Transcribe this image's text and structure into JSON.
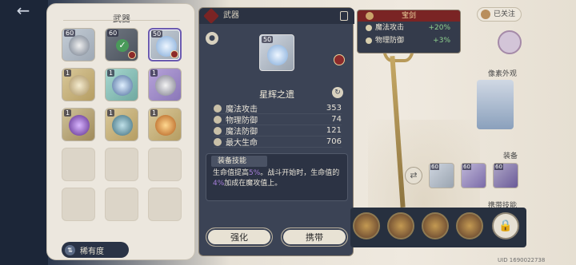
{
  "inventory": {
    "title": "武器",
    "rarity_label": "稀有度",
    "slots": [
      {
        "level": "60",
        "kind": "filled",
        "has_badge": false,
        "check": false
      },
      {
        "level": "60",
        "kind": "filled",
        "has_badge": true,
        "check": true
      },
      {
        "level": "50",
        "kind": "selected",
        "has_badge": true,
        "check": false
      },
      {
        "level": "1",
        "kind": "gold",
        "has_badge": false,
        "check": false
      },
      {
        "level": "1",
        "kind": "filled",
        "has_badge": false,
        "check": false
      },
      {
        "level": "1",
        "kind": "purple",
        "has_badge": false,
        "check": false
      },
      {
        "level": "1",
        "kind": "purple",
        "has_badge": false,
        "check": false
      },
      {
        "level": "1",
        "kind": "gold",
        "has_badge": false,
        "check": false
      },
      {
        "level": "1",
        "kind": "gold",
        "has_badge": false,
        "check": false
      }
    ]
  },
  "detail": {
    "header_title": "武器",
    "item_level": "50",
    "item_name": "星辉之遗",
    "stats": [
      {
        "label": "魔法攻击",
        "value": "353"
      },
      {
        "label": "物理防御",
        "value": "74"
      },
      {
        "label": "魔法防御",
        "value": "121"
      },
      {
        "label": "最大生命",
        "value": "706"
      }
    ],
    "skill_title": "装备技能",
    "skill_text_1": "生命值提高",
    "skill_pct_1": "5%",
    "skill_text_2": "。战斗开始时，生命值的",
    "skill_pct_2": "4%",
    "skill_text_3": "加成在魔攻值上。",
    "enhance_label": "强化",
    "equip_label": "携带"
  },
  "tooltip": {
    "title": "宝剑",
    "rows": [
      {
        "label": "魔法攻击",
        "value": "+20%"
      },
      {
        "label": "物理防御",
        "value": "+3%"
      }
    ]
  },
  "right": {
    "follow_label": "已关注",
    "appearance_label": "像素外观",
    "equip_label": "装备",
    "equipped": [
      {
        "level": "60"
      },
      {
        "level": "60"
      },
      {
        "level": "60"
      }
    ],
    "skills_label": "携带技能",
    "uid": "UID 1690022738"
  },
  "colors": {
    "panel_dark": "#3b4355",
    "accent_purple": "#a57ed8",
    "accent_green": "#8fd18f",
    "badge_red": "#8c2a2a"
  }
}
